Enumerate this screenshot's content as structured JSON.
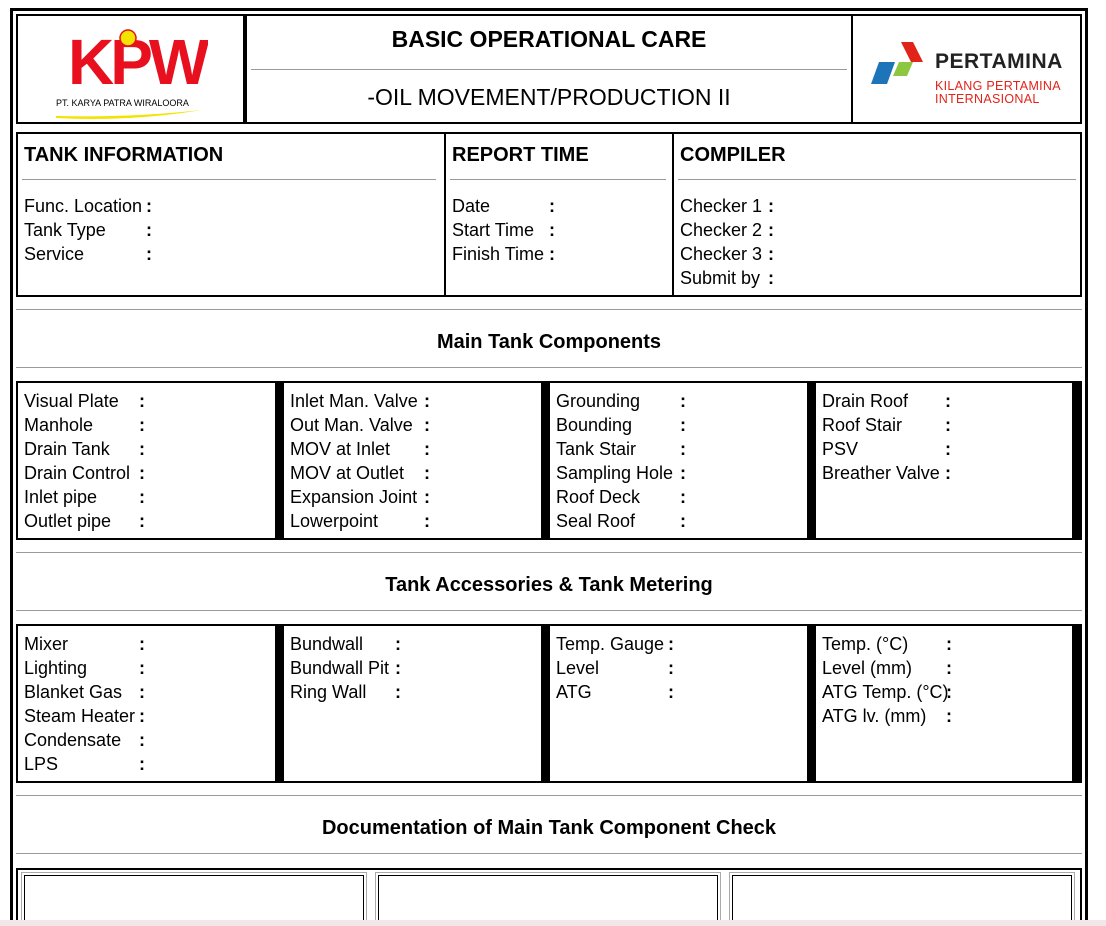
{
  "header": {
    "title": "BASIC OPERATIONAL CARE",
    "subtitle": "-OIL MOVEMENT/PRODUCTION II",
    "left_logo": {
      "text": "KPW",
      "company": "PT. KARYA PATRA WIRALOORA"
    },
    "right_logo": {
      "name": "PERTAMINA",
      "line1": "KILANG PERTAMINA",
      "line2": "INTERNASIONAL"
    }
  },
  "info": {
    "tank": {
      "heading": "TANK INFORMATION",
      "fields": [
        "Func. Location",
        "Tank Type",
        "Service"
      ]
    },
    "report": {
      "heading": "REPORT TIME",
      "fields": [
        "Date",
        "Start Time",
        "Finish Time"
      ]
    },
    "compiler": {
      "heading": "COMPILER",
      "fields": [
        "Checker 1",
        "Checker 2",
        "Checker 3",
        "Submit by"
      ]
    }
  },
  "sections": {
    "main": "Main Tank Components",
    "accessories": "Tank Accessories & Tank Metering",
    "documentation": "Documentation of Main Tank Component Check"
  },
  "main_components": [
    [
      "Visual Plate",
      "Manhole",
      "Drain Tank",
      "Drain Control",
      "Inlet pipe",
      "Outlet pipe"
    ],
    [
      "Inlet Man. Valve",
      "Out Man. Valve",
      "MOV at Inlet",
      "MOV at Outlet",
      "Expansion Joint",
      "Lowerpoint"
    ],
    [
      "Grounding",
      "Bounding",
      "Tank Stair",
      "Sampling Hole",
      "Roof Deck",
      "Seal Roof"
    ],
    [
      "Drain Roof",
      "Roof Stair",
      "PSV",
      "Breather Valve"
    ]
  ],
  "accessories": [
    [
      "Mixer",
      "Lighting",
      "Blanket Gas",
      "Steam Heater",
      "Condensate",
      "LPS"
    ],
    [
      "Bundwall",
      "Bundwall Pit",
      "Ring Wall"
    ],
    [
      "Temp. Gauge",
      "Level",
      "ATG"
    ],
    [
      "Temp. (°C)",
      "Level (mm)",
      "ATG Temp. (°C)",
      "ATG lv. (mm)"
    ]
  ],
  "colors": {
    "kpw_red": "#e8101e",
    "kpw_yellow": "#f2e400",
    "pertamina_red": "#e2231a",
    "pertamina_blue": "#1d74b9",
    "pertamina_green": "#8dc63f"
  }
}
